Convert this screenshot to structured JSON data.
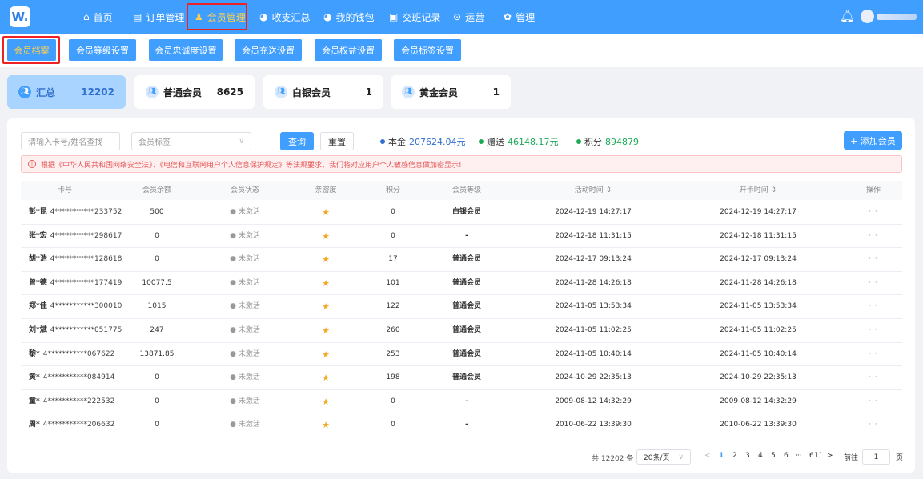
{
  "logo": "W.",
  "nav": {
    "items": [
      {
        "label": "首页",
        "icon": "home-icon"
      },
      {
        "label": "订单管理",
        "icon": "order-icon"
      },
      {
        "label": "会员管理",
        "icon": "member-icon"
      },
      {
        "label": "收支汇总",
        "icon": "pie-icon"
      },
      {
        "label": "我的钱包",
        "icon": "wallet-icon"
      },
      {
        "label": "交班记录",
        "icon": "shift-icon"
      },
      {
        "label": "运营",
        "icon": "ops-icon"
      },
      {
        "label": "管理",
        "icon": "gear-icon"
      }
    ],
    "active": "会员管理"
  },
  "subnav": {
    "items": [
      "会员档案",
      "会员等级设置",
      "会员忠诚度设置",
      "会员充送设置",
      "会员权益设置",
      "会员标签设置"
    ],
    "active": "会员档案"
  },
  "summary": [
    {
      "name": "汇总",
      "count": "12202"
    },
    {
      "name": "普通会员",
      "count": "8625"
    },
    {
      "name": "白银会员",
      "count": "1"
    },
    {
      "name": "黄金会员",
      "count": "1"
    }
  ],
  "filters": {
    "search_placeholder": "请输入卡号/姓名查找",
    "tag_placeholder": "会员标签",
    "query_label": "查询",
    "reset_label": "重置",
    "add_label": "+ 添加会员"
  },
  "stats": {
    "principal_label": "本金",
    "principal_value": "207624.04元",
    "bonus_label": "赠送",
    "bonus_value": "46148.17元",
    "points_label": "积分",
    "points_value": "894879",
    "colors": {
      "principal": "#2f6fcf",
      "bonus": "#1aaa55",
      "points": "#1aaa55"
    }
  },
  "notice": "根据《中华人民共和国网络安全法》、《电信和互联网用户个人信息保护规定》等法规要求，我们将对应用户个人敏感信息做加密显示!",
  "table": {
    "columns": [
      "卡号",
      "会员余额",
      "会员状态",
      "亲密度",
      "积分",
      "会员等级",
      "活动时间 ⇕",
      "开卡时间 ⇕",
      "操作"
    ],
    "rows": [
      {
        "name": "彭*昆",
        "card": "4***********233752",
        "balance": "500",
        "status": "● 未激活",
        "points": "0",
        "level": "白银会员",
        "active_time": "2024-12-19 14:27:17",
        "open_time": "2024-12-19 14:27:17"
      },
      {
        "name": "张*宏",
        "card": "4***********298617",
        "balance": "0",
        "status": "● 未激活",
        "points": "0",
        "level": "-",
        "active_time": "2024-12-18 11:31:15",
        "open_time": "2024-12-18 11:31:15"
      },
      {
        "name": "胡*浩",
        "card": "4***********128618",
        "balance": "0",
        "status": "● 未激活",
        "points": "17",
        "level": "普通会员",
        "active_time": "2024-12-17 09:13:24",
        "open_time": "2024-12-17 09:13:24"
      },
      {
        "name": "曾*德",
        "card": "4***********177419",
        "balance": "10077.5",
        "status": "● 未激活",
        "points": "101",
        "level": "普通会员",
        "active_time": "2024-11-28 14:26:18",
        "open_time": "2024-11-28 14:26:18"
      },
      {
        "name": "郑*佳",
        "card": "4***********300010",
        "balance": "1015",
        "status": "● 未激活",
        "points": "122",
        "level": "普通会员",
        "active_time": "2024-11-05 13:53:34",
        "open_time": "2024-11-05 13:53:34"
      },
      {
        "name": "刘*斌",
        "card": "4***********051775",
        "balance": "247",
        "status": "● 未激活",
        "points": "260",
        "level": "普通会员",
        "active_time": "2024-11-05 11:02:25",
        "open_time": "2024-11-05 11:02:25"
      },
      {
        "name": "黎*",
        "card": "4***********067622",
        "balance": "13871.85",
        "status": "● 未激活",
        "points": "253",
        "level": "普通会员",
        "active_time": "2024-11-05 10:40:14",
        "open_time": "2024-11-05 10:40:14"
      },
      {
        "name": "黄*",
        "card": "4***********084914",
        "balance": "0",
        "status": "● 未激活",
        "points": "198",
        "level": "普通会员",
        "active_time": "2024-10-29 22:35:13",
        "open_time": "2024-10-29 22:35:13"
      },
      {
        "name": "童*",
        "card": "4***********222532",
        "balance": "0",
        "status": "● 未激活",
        "points": "0",
        "level": "-",
        "active_time": "2009-08-12 14:32:29",
        "open_time": "2009-08-12 14:32:29"
      },
      {
        "name": "周*",
        "card": "4***********206632",
        "balance": "0",
        "status": "● 未激活",
        "points": "0",
        "level": "-",
        "active_time": "2010-06-22 13:39:30",
        "open_time": "2010-06-22 13:39:30"
      }
    ],
    "intimacy_icon": "★",
    "more_icon": "···"
  },
  "pagination": {
    "total": "共 12202 条",
    "page_size": "20条/页",
    "prev": "<",
    "pages": [
      "1",
      "2",
      "3",
      "4",
      "5",
      "6",
      "···",
      "611"
    ],
    "current": "1",
    "next": ">",
    "goto_label": "前往",
    "goto_value": "1",
    "page_suffix": "页"
  }
}
